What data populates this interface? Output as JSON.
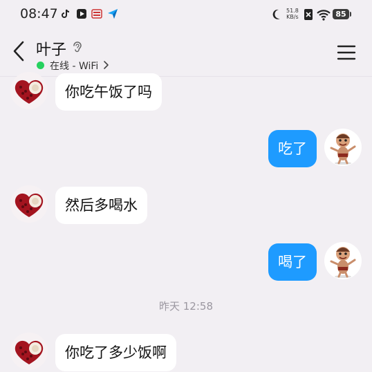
{
  "status_bar": {
    "time": "08:47",
    "net_speed_value": "51.8",
    "net_speed_unit": "KB/s",
    "battery": "85",
    "icons": [
      "douyin-icon",
      "video-player-icon",
      "news-app-icon",
      "feishu-icon",
      "moon-icon",
      "no-sim-icon",
      "wifi-icon",
      "battery-icon"
    ]
  },
  "header": {
    "title": "叶子",
    "status": "在线 - WiFi",
    "online_color": "#26d15f"
  },
  "messages": [
    {
      "direction": "in",
      "text": "你吃午饭了吗"
    },
    {
      "direction": "out",
      "text": "吃了"
    },
    {
      "direction": "in",
      "text": "然后多喝水"
    },
    {
      "direction": "out",
      "text": "喝了"
    },
    {
      "direction": "in",
      "text": "你吃了多少饭啊"
    }
  ],
  "timestamp": "昨天 12:58",
  "colors": {
    "background": "#f2eff3",
    "outgoing_bubble": "#1e9bff",
    "incoming_bubble": "#ffffff"
  }
}
